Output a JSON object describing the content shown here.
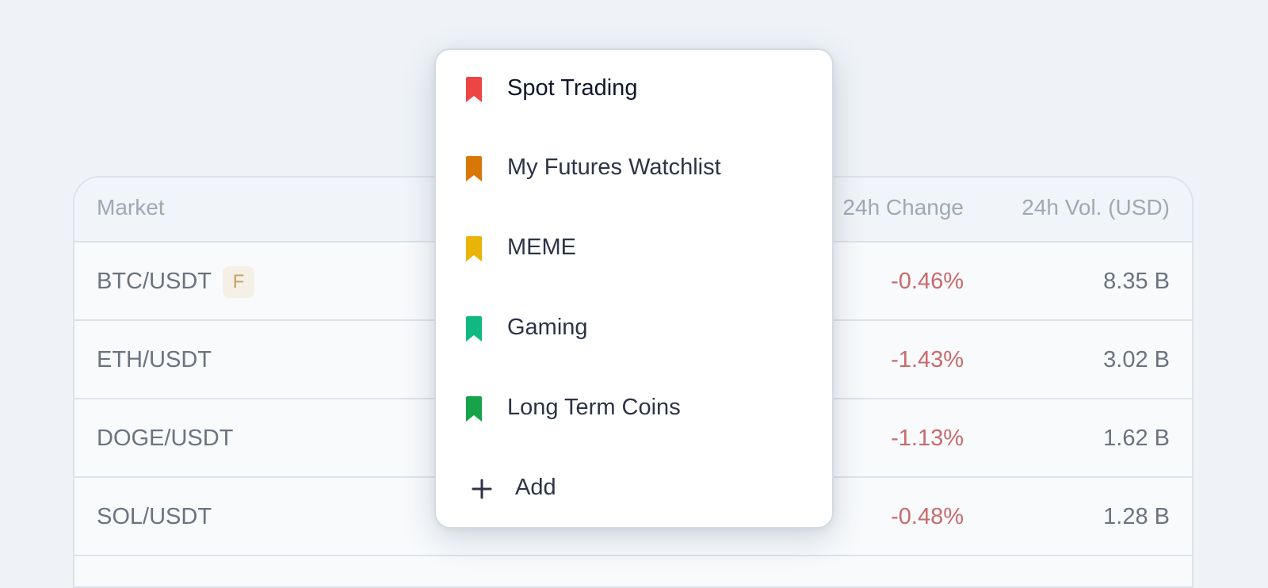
{
  "table": {
    "headers": {
      "market": "Market",
      "change": "24h Change",
      "volume": "24h Vol. (USD)"
    },
    "rows": [
      {
        "pair": "BTC/USDT",
        "badge": "F",
        "change": "-0.46%",
        "volume": "8.35 B"
      },
      {
        "pair": "ETH/USDT",
        "badge": "",
        "change": "-1.43%",
        "volume": "3.02 B"
      },
      {
        "pair": "DOGE/USDT",
        "badge": "",
        "change": "-1.13%",
        "volume": "1.62 B"
      },
      {
        "pair": "SOL/USDT",
        "badge": "",
        "change": "-0.48%",
        "volume": "1.28 B"
      }
    ]
  },
  "dropdown": {
    "items": [
      {
        "label": "Spot Trading",
        "icon": "bookmark-icon",
        "color": "#ef4444"
      },
      {
        "label": "My Futures Watchlist",
        "icon": "bookmark-icon",
        "color": "#d97706"
      },
      {
        "label": "MEME",
        "icon": "bookmark-icon",
        "color": "#eab308"
      },
      {
        "label": "Gaming",
        "icon": "bookmark-icon",
        "color": "#10b981"
      },
      {
        "label": "Long Term Coins",
        "icon": "bookmark-icon",
        "color": "#16a34a"
      }
    ],
    "add_label": "Add",
    "add_icon": "plus-icon"
  },
  "colors": {
    "negative_change": "#c96a6c",
    "futures_badge_text": "#c9a064",
    "futures_badge_bg": "#f5f0e6"
  }
}
